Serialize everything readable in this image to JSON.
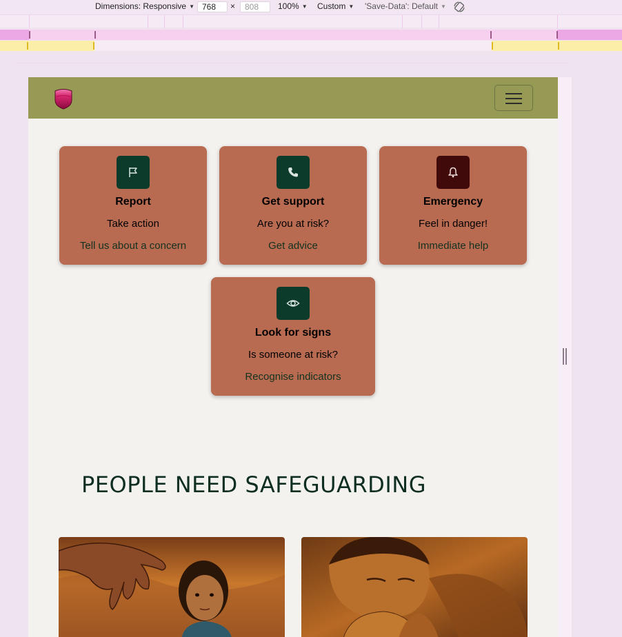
{
  "devtools": {
    "dimensions_label": "Dimensions: Responsive",
    "width_value": "768",
    "times": "×",
    "height_placeholder": "808",
    "zoom": "100%",
    "throttle": "Custom",
    "save_data": "'Save-Data': Default"
  },
  "navbar": {
    "bg_color": "#979a55",
    "logo_icon": "shield-logo",
    "menu_icon": "hamburger-icon"
  },
  "cards": [
    {
      "icon": "flag-icon",
      "title": "Report",
      "subtitle": "Take action",
      "link": "Tell us about a concern"
    },
    {
      "icon": "phone-icon",
      "title": "Get support",
      "subtitle": "Are you at risk?",
      "link": "Get advice"
    },
    {
      "icon": "bell-icon",
      "title": "Emergency",
      "subtitle": "Feel in danger!",
      "link": "Immediate help"
    },
    {
      "icon": "eye-icon",
      "title": "Look for signs",
      "subtitle": "Is someone at risk?",
      "link": "Recognise indicators"
    }
  ],
  "colors": {
    "card_bg": "#b86b51",
    "icon_bg": "#0d3b2b",
    "emergency_icon_bg": "#400a0a",
    "page_bg": "#f4f2ee"
  },
  "section": {
    "heading": "PEOPLE NEED SAFEGUARDING"
  }
}
